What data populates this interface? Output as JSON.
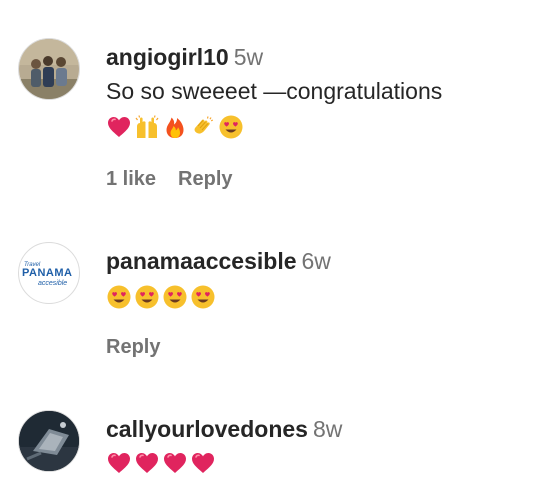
{
  "comments": [
    {
      "username": "angiogirl10",
      "age": "5w",
      "text": "So so sweeeet —congratulations",
      "emojis": [
        "red-heart",
        "raising-hands",
        "fire",
        "clapping-hands",
        "heart-eyes"
      ],
      "likes_label": "1 like",
      "reply_label": "Reply"
    },
    {
      "username": "panamaaccesible",
      "age": "6w",
      "avatar_logo": {
        "line1": "Travel",
        "line2": "PANAMA",
        "line3": "accesible"
      },
      "emojis": [
        "heart-eyes",
        "heart-eyes",
        "heart-eyes",
        "heart-eyes"
      ],
      "reply_label": "Reply"
    },
    {
      "username": "callyourlovedones",
      "age": "8w",
      "emojis": [
        "red-heart",
        "red-heart",
        "red-heart",
        "red-heart"
      ]
    }
  ],
  "colors": {
    "username": "#262626",
    "meta": "#737373",
    "heart": "#e0245e",
    "emoji_yellow": "#f7c02c",
    "logo_blue": "#1f5fa8"
  }
}
